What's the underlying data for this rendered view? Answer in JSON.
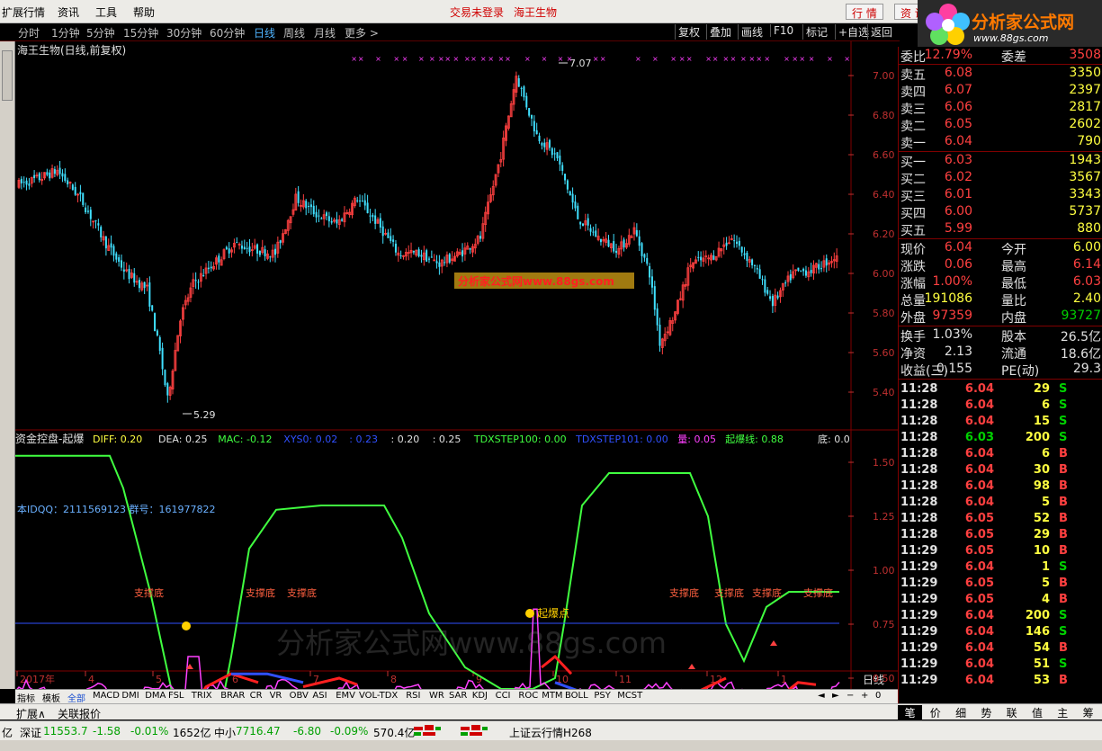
{
  "menu": {
    "items": [
      "扩展行情",
      "资讯",
      "工具",
      "帮助"
    ],
    "login_status": "交易未登录",
    "stock_name": "海王生物",
    "btn_quote": "行 情",
    "btn_trade": "资 讯"
  },
  "logo": {
    "site": "分析家公式网",
    "url": "www.88gs.com"
  },
  "toolbar": {
    "periods": [
      "分时",
      "1分钟",
      "5分钟",
      "15分钟",
      "30分钟",
      "60分钟",
      "日线",
      "周线",
      "月线",
      "更多 >"
    ],
    "active_period": "日线",
    "right_buttons": [
      "复权",
      "叠加",
      "画线",
      "F10",
      "标记",
      "+自选",
      "返回"
    ]
  },
  "main_chart": {
    "title": "海王生物(日线,前复权)",
    "high_label": "7.07",
    "low_label": "5.29",
    "price_axis": [
      "7.00",
      "6.80",
      "6.60",
      "6.40",
      "6.20",
      "6.00",
      "5.80",
      "5.60",
      "5.40"
    ],
    "watermark": "分析家公式网www.88gs.com"
  },
  "indicator": {
    "name": "资金控盘-起爆",
    "values": [
      {
        "label": "DIFF: 0.20",
        "color": "#ffff40"
      },
      {
        "label": "DEA: 0.25",
        "color": "#e0e0e0"
      },
      {
        "label": "MAC: -0.12",
        "color": "#40ff40"
      },
      {
        "label": "XYS0: 0.02",
        "color": "#3050ff"
      },
      {
        "label": ": 0.23",
        "color": "#3050ff"
      },
      {
        "label": ": 0.20",
        "color": "#e0e0e0"
      },
      {
        "label": ": 0.25",
        "color": "#e0e0e0"
      },
      {
        "label": "TDXSTEP100: 0.00",
        "color": "#40ff40"
      },
      {
        "label": "TDXSTEP101: 0.00",
        "color": "#3050ff"
      },
      {
        "label": "量: 0.05",
        "color": "#ff40ff"
      },
      {
        "label": "起爆线: 0.88",
        "color": "#40ff40"
      }
    ],
    "bottom_label": "底: 0.0",
    "qq_text": "本IDQQ：2111569123 群号：161977822",
    "axis": [
      "1.50",
      "1.25",
      "1.00",
      "0.75",
      "0.50"
    ],
    "support_label": "支撑底",
    "start_label": "起爆点",
    "watermark": "分析家公式网www.88gs.com"
  },
  "date_axis": [
    "2017年",
    "4",
    "5",
    "6",
    "7",
    "8",
    "9",
    "10",
    "11",
    "12",
    "1"
  ],
  "period_label": "日线",
  "indicator_tabs": [
    "指标",
    "模板",
    "全部",
    "MACD",
    "DMI",
    "DMA",
    "FSL",
    "TRIX",
    "BRAR",
    "CR",
    "VR",
    "OBV",
    "ASI",
    "EMV",
    "VOL-TDX",
    "RSI",
    "WR",
    "SAR",
    "KDJ",
    "CCI",
    "ROC",
    "MTM",
    "BOLL",
    "PSY",
    "MCST"
  ],
  "extension_tabs": [
    "扩展∧",
    "关联报价"
  ],
  "quote": {
    "wei_bi": {
      "label": "委比",
      "value": "12.79%",
      "label2": "委差",
      "value2": "3508"
    },
    "sell": [
      {
        "label": "卖五",
        "price": "6.08",
        "vol": "3350"
      },
      {
        "label": "卖四",
        "price": "6.07",
        "vol": "2397"
      },
      {
        "label": "卖三",
        "price": "6.06",
        "vol": "2817"
      },
      {
        "label": "卖二",
        "price": "6.05",
        "vol": "2602"
      },
      {
        "label": "卖一",
        "price": "6.04",
        "vol": "790"
      }
    ],
    "buy": [
      {
        "label": "买一",
        "price": "6.03",
        "vol": "1943"
      },
      {
        "label": "买二",
        "price": "6.02",
        "vol": "3567"
      },
      {
        "label": "买三",
        "price": "6.01",
        "vol": "3343"
      },
      {
        "label": "买四",
        "price": "6.00",
        "vol": "5737"
      },
      {
        "label": "买五",
        "price": "5.99",
        "vol": "880"
      }
    ],
    "stats": [
      {
        "l1": "现价",
        "v1": "6.04",
        "c1": "red",
        "l2": "今开",
        "v2": "6.00",
        "c2": "yellow"
      },
      {
        "l1": "涨跌",
        "v1": "0.06",
        "c1": "red",
        "l2": "最高",
        "v2": "6.14",
        "c2": "red"
      },
      {
        "l1": "涨幅",
        "v1": "1.00%",
        "c1": "red",
        "l2": "最低",
        "v2": "6.03",
        "c2": "red"
      },
      {
        "l1": "总量",
        "v1": "191086",
        "c1": "yellow",
        "l2": "量比",
        "v2": "2.40",
        "c2": "yellow"
      },
      {
        "l1": "外盘",
        "v1": "97359",
        "c1": "red",
        "l2": "内盘",
        "v2": "93727",
        "c2": "green"
      }
    ],
    "stats2": [
      {
        "l1": "换手",
        "v1": "1.03%",
        "l2": "股本",
        "v2": "26.5亿"
      },
      {
        "l1": "净资",
        "v1": "2.13",
        "l2": "流通",
        "v2": "18.6亿"
      },
      {
        "l1": "收益(三)",
        "v1": "0.155",
        "l2": "PE(动)",
        "v2": "29.3"
      }
    ],
    "ticks": [
      {
        "time": "11:28",
        "price": "6.04",
        "vol": "29",
        "bs": "S"
      },
      {
        "time": "11:28",
        "price": "6.04",
        "vol": "6",
        "bs": "S"
      },
      {
        "time": "11:28",
        "price": "6.04",
        "vol": "15",
        "bs": "S"
      },
      {
        "time": "11:28",
        "price": "6.03",
        "vol": "200",
        "bs": "S"
      },
      {
        "time": "11:28",
        "price": "6.04",
        "vol": "6",
        "bs": "B"
      },
      {
        "time": "11:28",
        "price": "6.04",
        "vol": "30",
        "bs": "B"
      },
      {
        "time": "11:28",
        "price": "6.04",
        "vol": "98",
        "bs": "B"
      },
      {
        "time": "11:28",
        "price": "6.04",
        "vol": "5",
        "bs": "B"
      },
      {
        "time": "11:28",
        "price": "6.05",
        "vol": "52",
        "bs": "B"
      },
      {
        "time": "11:28",
        "price": "6.05",
        "vol": "29",
        "bs": "B"
      },
      {
        "time": "11:29",
        "price": "6.05",
        "vol": "10",
        "bs": "B"
      },
      {
        "time": "11:29",
        "price": "6.04",
        "vol": "1",
        "bs": "S"
      },
      {
        "time": "11:29",
        "price": "6.05",
        "vol": "5",
        "bs": "B"
      },
      {
        "time": "11:29",
        "price": "6.05",
        "vol": "4",
        "bs": "B"
      },
      {
        "time": "11:29",
        "price": "6.04",
        "vol": "200",
        "bs": "S"
      },
      {
        "time": "11:29",
        "price": "6.04",
        "vol": "146",
        "bs": "S"
      },
      {
        "time": "11:29",
        "price": "6.04",
        "vol": "54",
        "bs": "B"
      },
      {
        "time": "11:29",
        "price": "6.04",
        "vol": "51",
        "bs": "S"
      },
      {
        "time": "11:29",
        "price": "6.04",
        "vol": "53",
        "bs": "B"
      }
    ],
    "tabs": [
      "笔",
      "价",
      "细",
      "势",
      "联",
      "值",
      "主",
      "筹"
    ]
  },
  "statusbar": {
    "prefix": "亿",
    "index1_name": "深证",
    "index1_value": "11553.7",
    "index1_change": "-1.58",
    "index1_pct": "-0.01%",
    "index1_amount": "1652亿",
    "index2_name": "中小",
    "index2_value": "7716.47",
    "index2_change": "-6.80",
    "index2_pct": "-0.09%",
    "index2_amount": "570.4亿",
    "server": "上证云行情H268"
  },
  "colors": {
    "up": "#ff4040",
    "down": "#40e0ff",
    "green_line": "#40ff40",
    "magenta": "#ff40ff",
    "blue": "#3050ff"
  }
}
